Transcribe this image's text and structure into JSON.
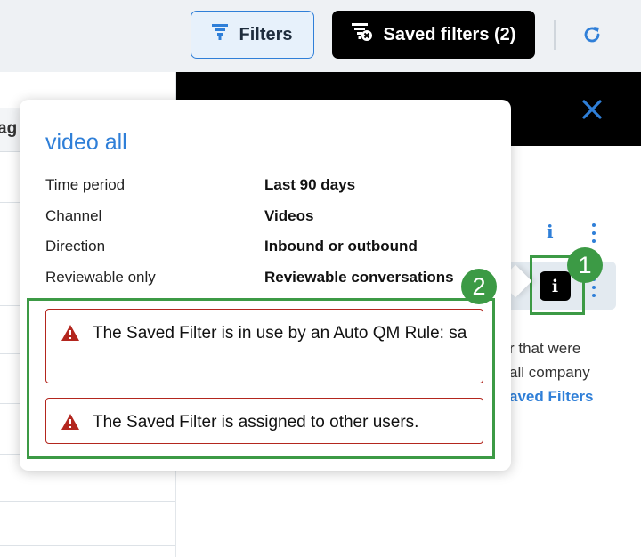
{
  "toolbar": {
    "filters_label": "Filters",
    "saved_filters_label": "Saved filters (2)"
  },
  "table": {
    "column_header": "ag"
  },
  "panel": {
    "description_line1": "r that were",
    "description_line2": "all company",
    "link": "aved Filters"
  },
  "popover": {
    "title": "video all",
    "rows": [
      {
        "label": "Time period",
        "value": "Last 90 days"
      },
      {
        "label": "Channel",
        "value": "Videos"
      },
      {
        "label": "Direction",
        "value": "Inbound or outbound"
      },
      {
        "label": "Reviewable only",
        "value": "Reviewable conversations"
      }
    ],
    "warnings": [
      "The Saved Filter is in use by an Auto QM Rule: sa",
      "The Saved Filter is assigned to other users."
    ]
  },
  "annotations": {
    "badge1": "1",
    "badge2": "2"
  },
  "colors": {
    "accent": "#2f7fd8",
    "callout": "#3c9a45",
    "warning": "#b3261e"
  }
}
